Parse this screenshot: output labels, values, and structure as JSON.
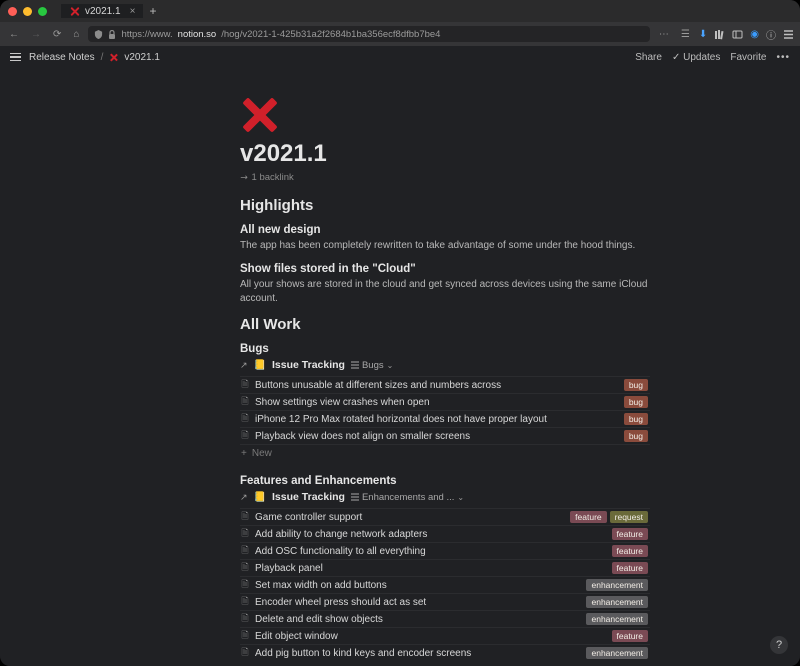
{
  "browser": {
    "tab_title": "v2021.1",
    "url_prefix": "https://www.",
    "url_host": "notion.so",
    "url_path": "/hog/v2021-1-425b31a2f2684b1ba356ecf8dfbb7be4"
  },
  "topbar": {
    "breadcrumb_root": "Release Notes",
    "breadcrumb_page": "v2021.1",
    "share": "Share",
    "updates": "Updates",
    "favorite": "Favorite"
  },
  "page": {
    "title": "v2021.1",
    "backlink": "1 backlink",
    "sections": {
      "highlights": {
        "heading": "Highlights",
        "items": [
          {
            "title": "All new design",
            "body": "The app has been completely rewritten to take advantage of some under the hood things."
          },
          {
            "title": "Show files stored in the \"Cloud\"",
            "body": "All your shows are stored in the cloud and get synced across devices using the same iCloud account."
          }
        ]
      },
      "allwork": {
        "heading": "All Work",
        "bugs": {
          "heading": "Bugs",
          "db_name": "Issue Tracking",
          "view": "Bugs",
          "rows": [
            {
              "title": "Buttons unusable at different sizes and numbers across",
              "tags": [
                "bug"
              ]
            },
            {
              "title": "Show settings view crashes when open",
              "tags": [
                "bug"
              ]
            },
            {
              "title": "iPhone 12 Pro Max rotated horizontal does not have proper layout",
              "tags": [
                "bug"
              ]
            },
            {
              "title": "Playback view does not align on smaller screens",
              "tags": [
                "bug"
              ]
            }
          ],
          "new": "New"
        },
        "features": {
          "heading": "Features and Enhancements",
          "db_name": "Issue Tracking",
          "view": "Enhancements and ...",
          "rows": [
            {
              "title": "Game controller support",
              "tags": [
                "feature",
                "request"
              ]
            },
            {
              "title": "Add ability to change network adapters",
              "tags": [
                "feature"
              ]
            },
            {
              "title": "Add OSC functionality to all everything",
              "tags": [
                "feature"
              ]
            },
            {
              "title": "Playback panel",
              "tags": [
                "feature"
              ]
            },
            {
              "title": "Set max width on add buttons",
              "tags": [
                "enhancement"
              ]
            },
            {
              "title": "Encoder wheel press should act as set",
              "tags": [
                "enhancement"
              ]
            },
            {
              "title": "Delete and edit show objects",
              "tags": [
                "enhancement"
              ]
            },
            {
              "title": "Edit object window",
              "tags": [
                "feature"
              ]
            },
            {
              "title": "Add pig button to kind keys and encoder screens",
              "tags": [
                "enhancement"
              ]
            }
          ]
        }
      }
    }
  },
  "tag_labels": {
    "bug": "bug",
    "feature": "feature",
    "request": "request",
    "enhancement": "enhancement"
  }
}
